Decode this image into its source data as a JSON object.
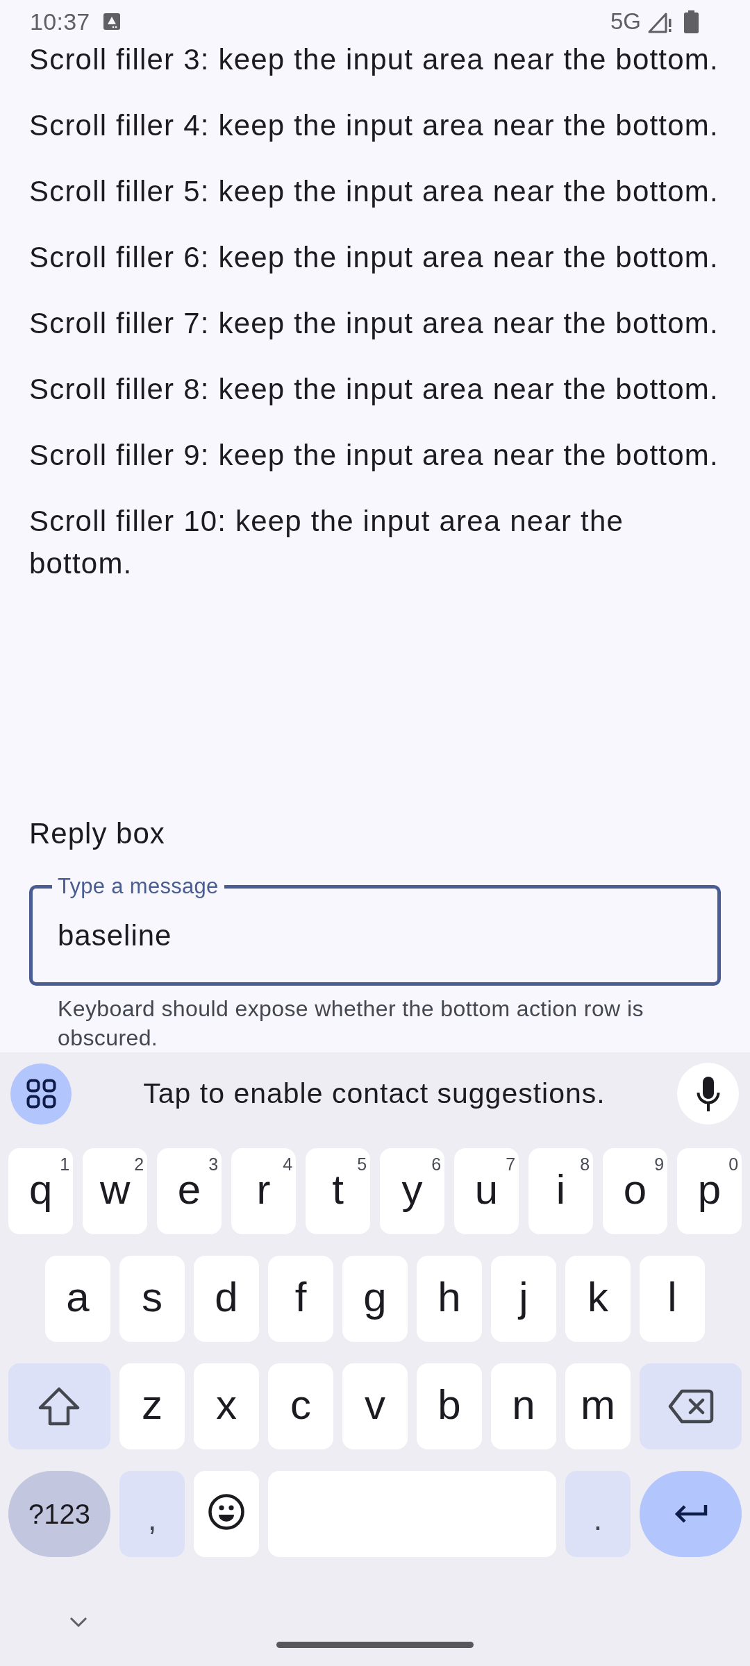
{
  "status_bar": {
    "time": "10:37",
    "network": "5G"
  },
  "content": {
    "paragraphs": [
      "Scroll filler 3: keep the input area near the bottom.",
      "Scroll filler 4: keep the input area near the bottom.",
      "Scroll filler 5: keep the input area near the bottom.",
      "Scroll filler 6: keep the input area near the bottom.",
      "Scroll filler 7: keep the input area near the bottom.",
      "Scroll filler 8: keep the input area near the bottom.",
      "Scroll filler 9: keep the input area near the bottom.",
      "Scroll filler 10: keep the input area near the bottom."
    ],
    "reply": {
      "title": "Reply box",
      "field": {
        "label": "Type a message",
        "value": "baseline",
        "focused": true
      },
      "helper_text": "Keyboard should expose whether the bottom action row is obscured."
    }
  },
  "keyboard": {
    "suggestion": "Tap to enable contact suggestions.",
    "rows": [
      {
        "keys": [
          {
            "kind": "letter",
            "label": "q",
            "hint": "1"
          },
          {
            "kind": "letter",
            "label": "w",
            "hint": "2"
          },
          {
            "kind": "letter",
            "label": "e",
            "hint": "3"
          },
          {
            "kind": "letter",
            "label": "r",
            "hint": "4"
          },
          {
            "kind": "letter",
            "label": "t",
            "hint": "5"
          },
          {
            "kind": "letter",
            "label": "y",
            "hint": "6"
          },
          {
            "kind": "letter",
            "label": "u",
            "hint": "7"
          },
          {
            "kind": "letter",
            "label": "i",
            "hint": "8"
          },
          {
            "kind": "letter",
            "label": "o",
            "hint": "9"
          },
          {
            "kind": "letter",
            "label": "p",
            "hint": "0"
          }
        ]
      },
      {
        "keys": [
          {
            "kind": "letter",
            "label": "a"
          },
          {
            "kind": "letter",
            "label": "s"
          },
          {
            "kind": "letter",
            "label": "d"
          },
          {
            "kind": "letter",
            "label": "f"
          },
          {
            "kind": "letter",
            "label": "g"
          },
          {
            "kind": "letter",
            "label": "h"
          },
          {
            "kind": "letter",
            "label": "j"
          },
          {
            "kind": "letter",
            "label": "k"
          },
          {
            "kind": "letter",
            "label": "l"
          }
        ]
      },
      {
        "keys": [
          {
            "kind": "shift"
          },
          {
            "kind": "letter",
            "label": "z"
          },
          {
            "kind": "letter",
            "label": "x"
          },
          {
            "kind": "letter",
            "label": "c"
          },
          {
            "kind": "letter",
            "label": "v"
          },
          {
            "kind": "letter",
            "label": "b"
          },
          {
            "kind": "letter",
            "label": "n"
          },
          {
            "kind": "letter",
            "label": "m"
          },
          {
            "kind": "backspace"
          }
        ]
      },
      {
        "keys": [
          {
            "kind": "symbols",
            "label": "?123"
          },
          {
            "kind": "punct",
            "label": ","
          },
          {
            "kind": "emoji"
          },
          {
            "kind": "space"
          },
          {
            "kind": "punct",
            "label": "."
          },
          {
            "kind": "enter"
          }
        ]
      }
    ]
  }
}
